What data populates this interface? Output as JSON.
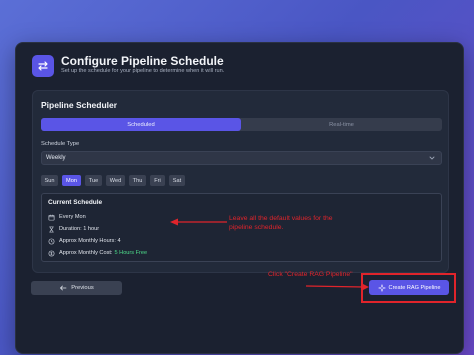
{
  "header": {
    "title": "Configure Pipeline Schedule",
    "subtitle": "Set up the schedule for your pipeline to determine when it will run.",
    "icon": "swap-arrows-icon"
  },
  "scheduler": {
    "title": "Pipeline Scheduler",
    "tabs": [
      {
        "label": "Scheduled",
        "active": true
      },
      {
        "label": "Real-time",
        "active": false
      }
    ],
    "schedule_type_label": "Schedule Type",
    "schedule_type_value": "Weekly",
    "days": [
      {
        "label": "Sun",
        "active": false
      },
      {
        "label": "Mon",
        "active": true
      },
      {
        "label": "Tue",
        "active": false
      },
      {
        "label": "Wed",
        "active": false
      },
      {
        "label": "Thu",
        "active": false
      },
      {
        "label": "Fri",
        "active": false
      },
      {
        "label": "Sat",
        "active": false
      }
    ],
    "current": {
      "title": "Current Schedule",
      "every": "Every Mon",
      "duration": "Duration: 1 hour",
      "hours": "Approx Monthly Hours: 4",
      "cost_label": "Approx Monthly Cost:",
      "cost_value": "5 Hours Free"
    }
  },
  "footer": {
    "previous_label": "Previous",
    "create_label": "Create RAG Pipeline"
  },
  "annotations": {
    "left_note": "Leave all the default values for the pipeline schedule.",
    "right_note": "Click \"Create RAG Pipeline\""
  },
  "colors": {
    "accent": "#5a55e6",
    "annotation": "#e0242b",
    "free": "#4ddc8a"
  }
}
